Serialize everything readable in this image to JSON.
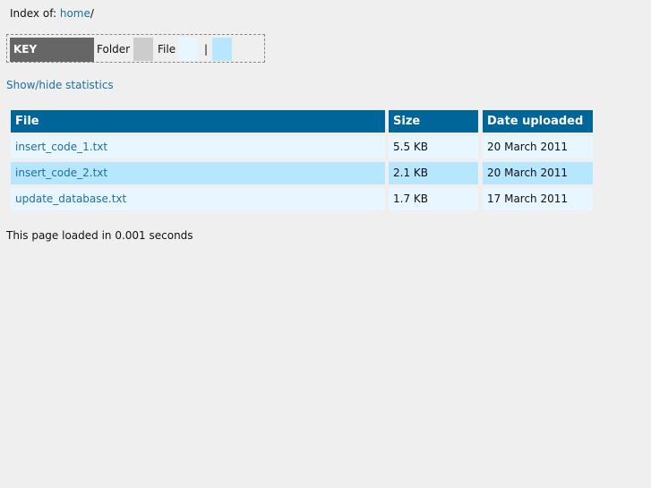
{
  "header": {
    "index_prefix": "Index of: ",
    "path_link": "home",
    "path_suffix": "/"
  },
  "key": {
    "title": "KEY",
    "folder_label": "Folder",
    "file_label": "File",
    "separator": "|",
    "colors": {
      "key_bg": "#666666",
      "folder": "#cccccc",
      "file": "#e8f6ff",
      "file_alt": "#b7e6ff"
    }
  },
  "stats_toggle": "Show/hide statistics",
  "table": {
    "headers": {
      "file": "File",
      "size": "Size",
      "date": "Date uploaded"
    },
    "header_color": "#006699",
    "rows": [
      {
        "name": "insert_code_1.txt",
        "size": "5.5 KB",
        "date": "20 March 2011",
        "bg": "#e8f6ff"
      },
      {
        "name": "insert_code_2.txt",
        "size": "2.1 KB",
        "date": "20 March 2011",
        "bg": "#b7e6ff"
      },
      {
        "name": "update_database.txt",
        "size": "1.7 KB",
        "date": "17 March 2011",
        "bg": "#e8f6ff"
      }
    ]
  },
  "footer": "This page loaded in 0.001 seconds"
}
